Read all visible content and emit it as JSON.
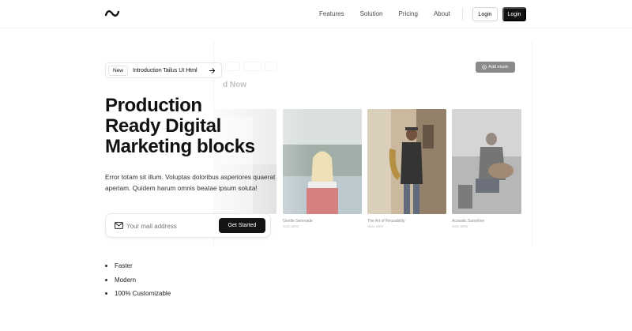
{
  "nav": {
    "logo_icon": "tilde-logo-icon",
    "links": [
      "Features",
      "Solution",
      "Pricing",
      "About"
    ],
    "login_outline": "Login",
    "login_dark": "Login"
  },
  "badge": {
    "tag": "New",
    "text": "Introduction Tailus UI Html",
    "icon": "arrow-right-icon"
  },
  "hero": {
    "title_lines": [
      "Production",
      "Ready Digital",
      "Marketing blocks"
    ],
    "description": "Error totam sit illum. Voluptas doloribus asperiores quaerat aperiam. Quidem harum omnis beatae ipsum soluta!"
  },
  "form": {
    "icon": "mail-icon",
    "placeholder": "Your mail address",
    "button": "Get Started"
  },
  "features": [
    "Faster",
    "Modern",
    "100% Customizable"
  ],
  "mockup": {
    "heading": "d Now",
    "add_button": "Add music",
    "captions": [
      {
        "title": "Gentle Serenade",
        "sub": "Solo artist"
      },
      {
        "title": "The Art of Reusability",
        "sub": "Solo artist"
      },
      {
        "title": "Acoustic Sunshine",
        "sub": "Solo artist"
      }
    ]
  }
}
